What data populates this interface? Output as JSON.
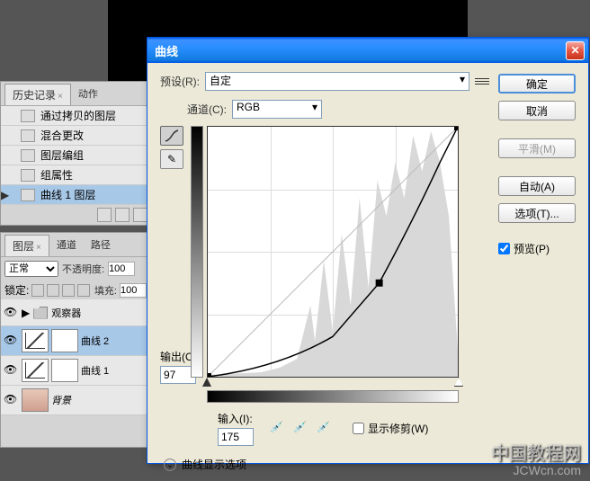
{
  "history_panel": {
    "tabs": [
      "历史记录",
      "动作"
    ],
    "items": [
      {
        "label": "通过拷贝的图层"
      },
      {
        "label": "混合更改"
      },
      {
        "label": "图层编组"
      },
      {
        "label": "组属性"
      },
      {
        "label": "曲线 1 图层",
        "selected": true
      }
    ]
  },
  "layers_panel": {
    "tabs": [
      "图层",
      "通道",
      "路径"
    ],
    "blend_mode": "正常",
    "opacity_label": "不透明度:",
    "opacity_value": "100",
    "lock_label": "锁定:",
    "fill_label": "填充:",
    "fill_value": "100",
    "layers": [
      {
        "name": "观察器",
        "type": "folder"
      },
      {
        "name": "曲线 2",
        "type": "curves",
        "selected": true
      },
      {
        "name": "曲线 1",
        "type": "curves"
      },
      {
        "name": "背景",
        "type": "eye",
        "italic": true
      }
    ]
  },
  "dialog": {
    "title": "曲线",
    "preset_label": "预设(R):",
    "preset_value": "自定",
    "channel_label": "通道(C):",
    "channel_value": "RGB",
    "output_label": "输出(O):",
    "output_value": "97",
    "input_label": "输入(I):",
    "input_value": "175",
    "clip_label": "显示修剪(W)",
    "expand_label": "曲线显示选项",
    "buttons": {
      "ok": "确定",
      "cancel": "取消",
      "smooth": "平滑(M)",
      "auto": "自动(A)",
      "options": "选项(T)...",
      "preview": "预览(P)"
    }
  },
  "chart_data": {
    "type": "line",
    "title": "曲线",
    "xlabel": "输入",
    "ylabel": "输出",
    "xlim": [
      0,
      255
    ],
    "ylim": [
      0,
      255
    ],
    "series": [
      {
        "name": "baseline",
        "values": [
          [
            0,
            0
          ],
          [
            255,
            255
          ]
        ]
      },
      {
        "name": "curve",
        "values": [
          [
            0,
            0
          ],
          [
            60,
            15
          ],
          [
            120,
            45
          ],
          [
            175,
            97
          ],
          [
            210,
            160
          ],
          [
            240,
            225
          ],
          [
            255,
            255
          ]
        ]
      }
    ],
    "control_point": {
      "input": 175,
      "output": 97
    }
  },
  "watermark": "中国教程网",
  "watermark2": "JCWcn.com"
}
